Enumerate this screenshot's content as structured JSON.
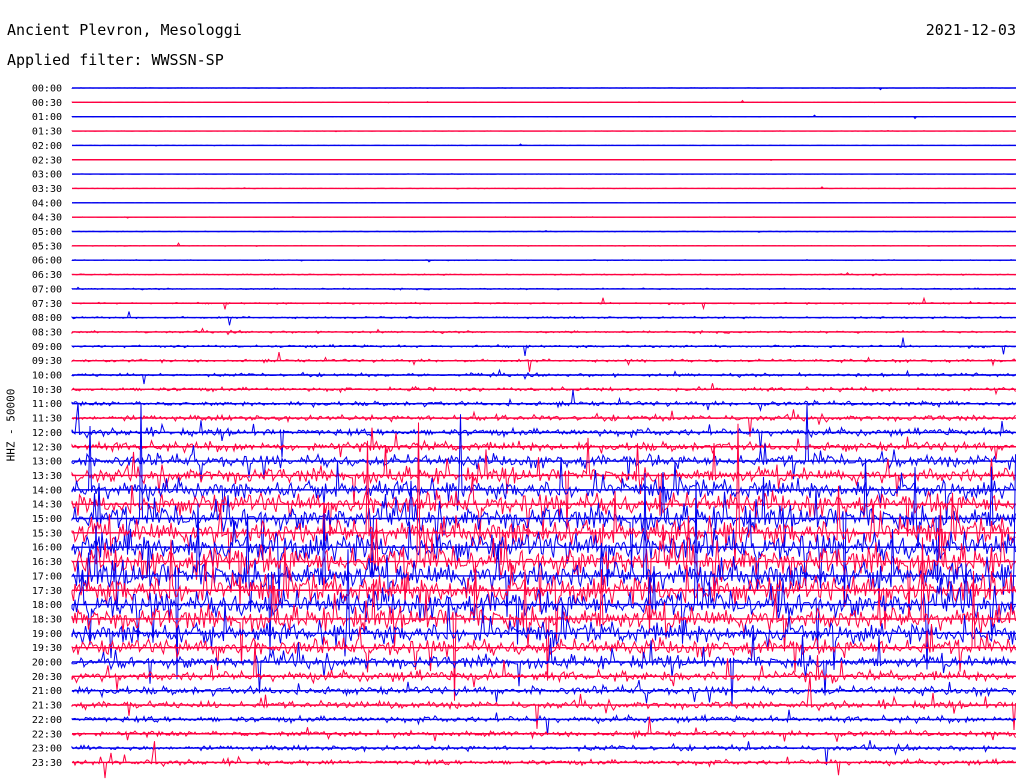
{
  "header": {
    "title": "Ancient Plevron, Mesologgi",
    "date": "2021-12-03",
    "filter_text": "Applied filter: WWSSN-SP"
  },
  "chart_data": {
    "type": "line",
    "chart_kind": "helicorder (seismogram drum plot)",
    "ylabel": "HHZ - 50000",
    "line_colors": [
      "#0000ee",
      "#ff0040"
    ],
    "rows": [
      "00:00",
      "00:30",
      "01:00",
      "01:30",
      "02:00",
      "02:30",
      "03:00",
      "03:30",
      "04:00",
      "04:30",
      "05:00",
      "05:30",
      "06:00",
      "06:30",
      "07:00",
      "07:30",
      "08:00",
      "08:30",
      "09:00",
      "09:30",
      "10:00",
      "10:30",
      "11:00",
      "11:30",
      "12:00",
      "12:30",
      "13:00",
      "13:30",
      "14:00",
      "14:30",
      "15:00",
      "15:30",
      "16:00",
      "16:30",
      "17:00",
      "17:30",
      "18:00",
      "18:30",
      "19:00",
      "19:30",
      "20:00",
      "20:30",
      "21:00",
      "21:30",
      "22:00",
      "22:30",
      "23:00",
      "23:30"
    ],
    "relative_amplitude": [
      0.08,
      0.07,
      0.09,
      0.07,
      0.07,
      0.08,
      0.1,
      0.08,
      0.1,
      0.1,
      0.12,
      0.14,
      0.18,
      0.22,
      0.28,
      0.32,
      0.38,
      0.42,
      0.5,
      0.55,
      0.62,
      0.75,
      0.9,
      1.1,
      1.4,
      1.8,
      2.4,
      3.0,
      3.6,
      4.2,
      4.8,
      5.2,
      5.6,
      5.8,
      5.8,
      5.6,
      5.2,
      4.6,
      4.0,
      3.2,
      2.5,
      2.0,
      1.6,
      1.4,
      1.2,
      1.1,
      1.0,
      1.0
    ]
  }
}
